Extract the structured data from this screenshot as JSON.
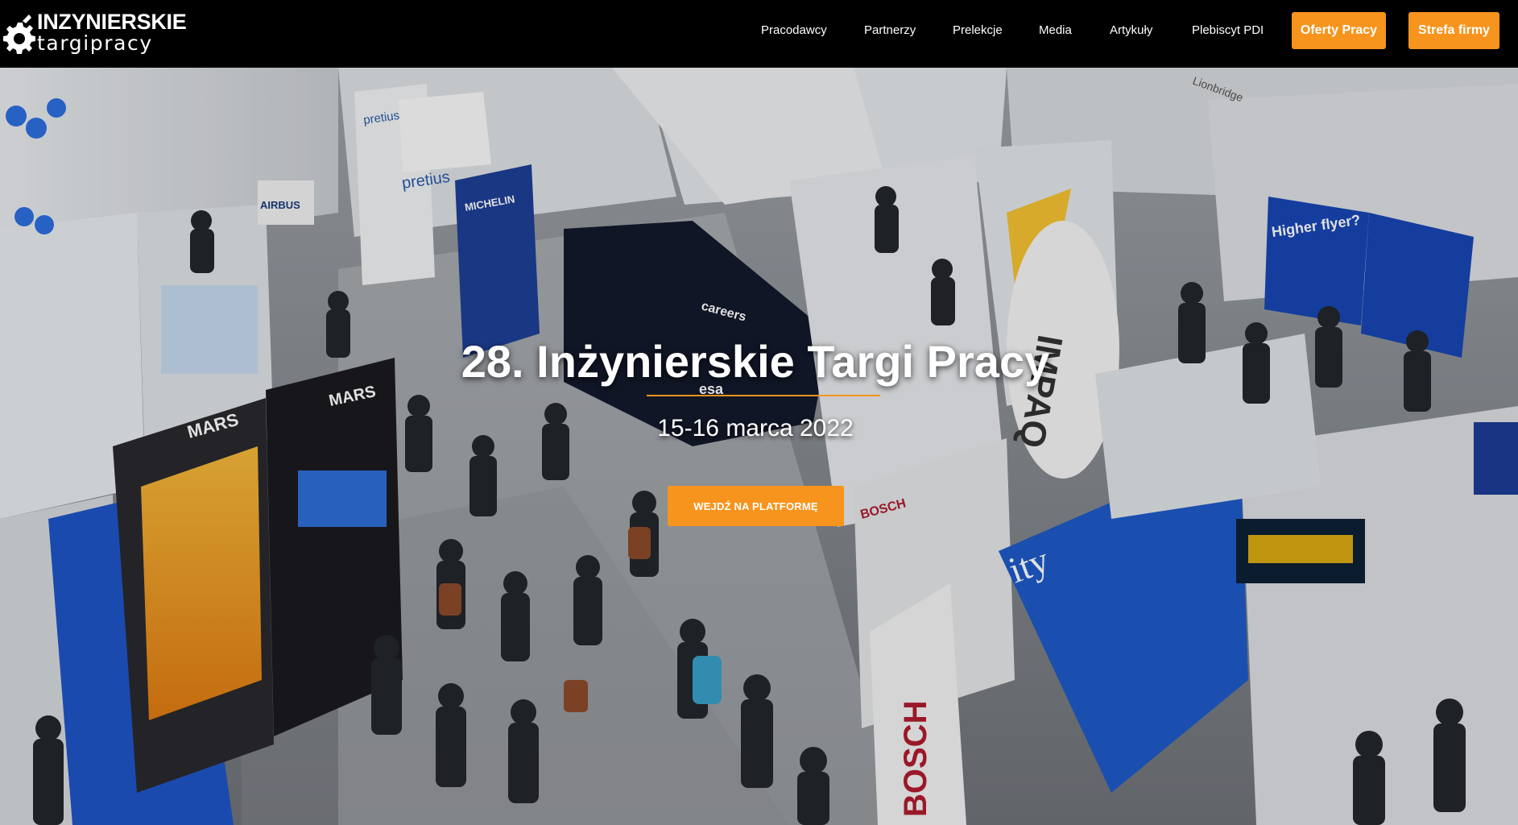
{
  "brand": {
    "line1": "INZYNIERSKIE",
    "line2": "targipracy",
    "icon": "gear-icon"
  },
  "nav": {
    "links": [
      {
        "label": "Pracodawcy"
      },
      {
        "label": "Partnerzy"
      },
      {
        "label": "Prelekcje"
      },
      {
        "label": "Media"
      },
      {
        "label": "Artykuły"
      },
      {
        "label": "Plebiscyt PDI"
      }
    ],
    "buttons": [
      {
        "label": "Oferty Pracy"
      },
      {
        "label": "Strefa firmy"
      }
    ]
  },
  "hero": {
    "title": "28. Inżynierskie Targi Pracy",
    "subtitle": "15-16 marca 2022",
    "cta": "WEJDŹ NA PLATFORMĘ",
    "signs": {
      "pretius": "pretius",
      "airbus": "AIRBUS",
      "michelin": "MICHELIN",
      "mars": "MARS",
      "careers": "careers",
      "esa": "esa",
      "bosch": "BOSCH",
      "higher_flyer": "Higher flyer?",
      "impaq": "IMPAQ",
      "lionbridge": "Lionbridge"
    }
  },
  "colors": {
    "accent": "#f7941d",
    "navbar": "#000000",
    "text": "#ffffff"
  }
}
